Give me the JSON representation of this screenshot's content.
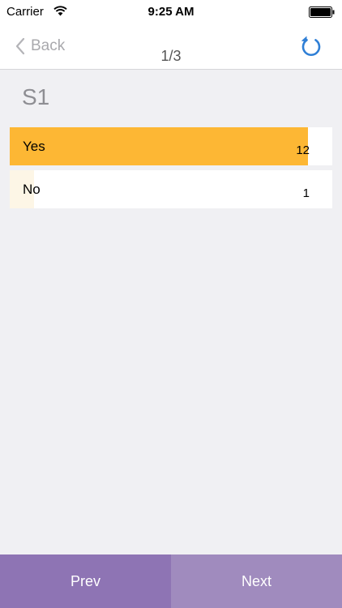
{
  "status_bar": {
    "carrier": "Carrier",
    "time": "9:25 AM",
    "icons": [
      "wifi-icon",
      "battery-icon"
    ]
  },
  "nav": {
    "back_label": "Back",
    "title": "1/3",
    "back_icon": "chevron-left-icon",
    "refresh_icon": "refresh-icon"
  },
  "question": {
    "title": "S1",
    "answers": [
      {
        "label": "Yes",
        "count": "12",
        "fraction": 0.925
      },
      {
        "label": "No",
        "count": "1",
        "fraction": 0.075
      }
    ]
  },
  "footer": {
    "prev_label": "Prev",
    "next_label": "Next"
  },
  "colors": {
    "accent_blue": "#2f7fd6",
    "yes_fill": "#fdb734",
    "no_fill": "#fdf6e6",
    "prev_bg": "#8e74b4",
    "next_bg": "#a08bbe",
    "page_bg": "#f0f0f3"
  }
}
